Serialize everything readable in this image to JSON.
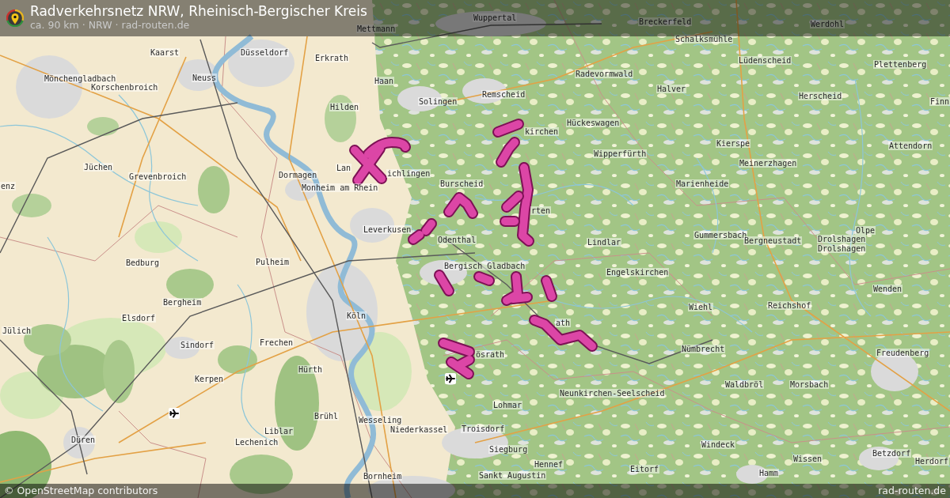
{
  "header": {
    "title": "Radverkehrsnetz NRW, Rheinisch-Bergischer Kreis",
    "subtitle": "ca. 90 km · NRW · rad-routen.de"
  },
  "map": {
    "place_labels": [
      "Wuppertal",
      "Mettmann",
      "Breckerfeld",
      "Werdohl",
      "Schalksmühle",
      "Kaarst",
      "Düsseldorf",
      "Erkrath",
      "Lüdenscheid",
      "Plettenberg",
      "Mönchengladbach",
      "Neuss",
      "Korschenbroich",
      "Haan",
      "Radevormwald",
      "Hilden",
      "Solingen",
      "Remscheid",
      "Halver",
      "Herscheid",
      "Finn",
      "kirchen",
      "Hückeswagen",
      "Wipperfürth",
      "Kierspe",
      "Attendorn",
      "Jüchen",
      "Grevenbroich",
      "Dormagen",
      "Lan",
      "ichlingen",
      "Meinerzhagen",
      "enz",
      "Monheim am Rhein",
      "Burscheid",
      "Marienheide",
      "rten",
      "Leverkusen",
      "Odenthal",
      "Lindlar",
      "Gummersbach",
      "Bergneustadt",
      "Drolshagen",
      "Olpe",
      "Drolshagen",
      "Bedburg",
      "Pulheim",
      "Bergisch Gladbach",
      "Engelskirchen",
      "Wenden",
      "Bergheim",
      "Wiehl",
      "Reichshof",
      "Elsdorf",
      "Köln",
      "Jülich",
      "ath",
      "Sindorf",
      "Frechen",
      "ösrath",
      "Nümbrecht",
      "Freudenberg",
      "Hürth",
      "Kerpen",
      "Neunkirchen-Seelscheid",
      "Waldbröl",
      "Morsbach",
      "Lohmar",
      "Brühl",
      "Wesseling",
      "Liblar",
      "Niederkassel",
      "Troisdorf",
      "Düren",
      "Lechenich",
      "Siegburg",
      "Windeck",
      "Hennef",
      "Bornheim",
      "Sankt Augustin",
      "Eitorf",
      "Wissen",
      "Betzdorf",
      "Herdorf",
      "Hamm"
    ]
  },
  "footer": {
    "attribution": "© OpenStreetMap contributors",
    "site": "rad-routen.de"
  }
}
